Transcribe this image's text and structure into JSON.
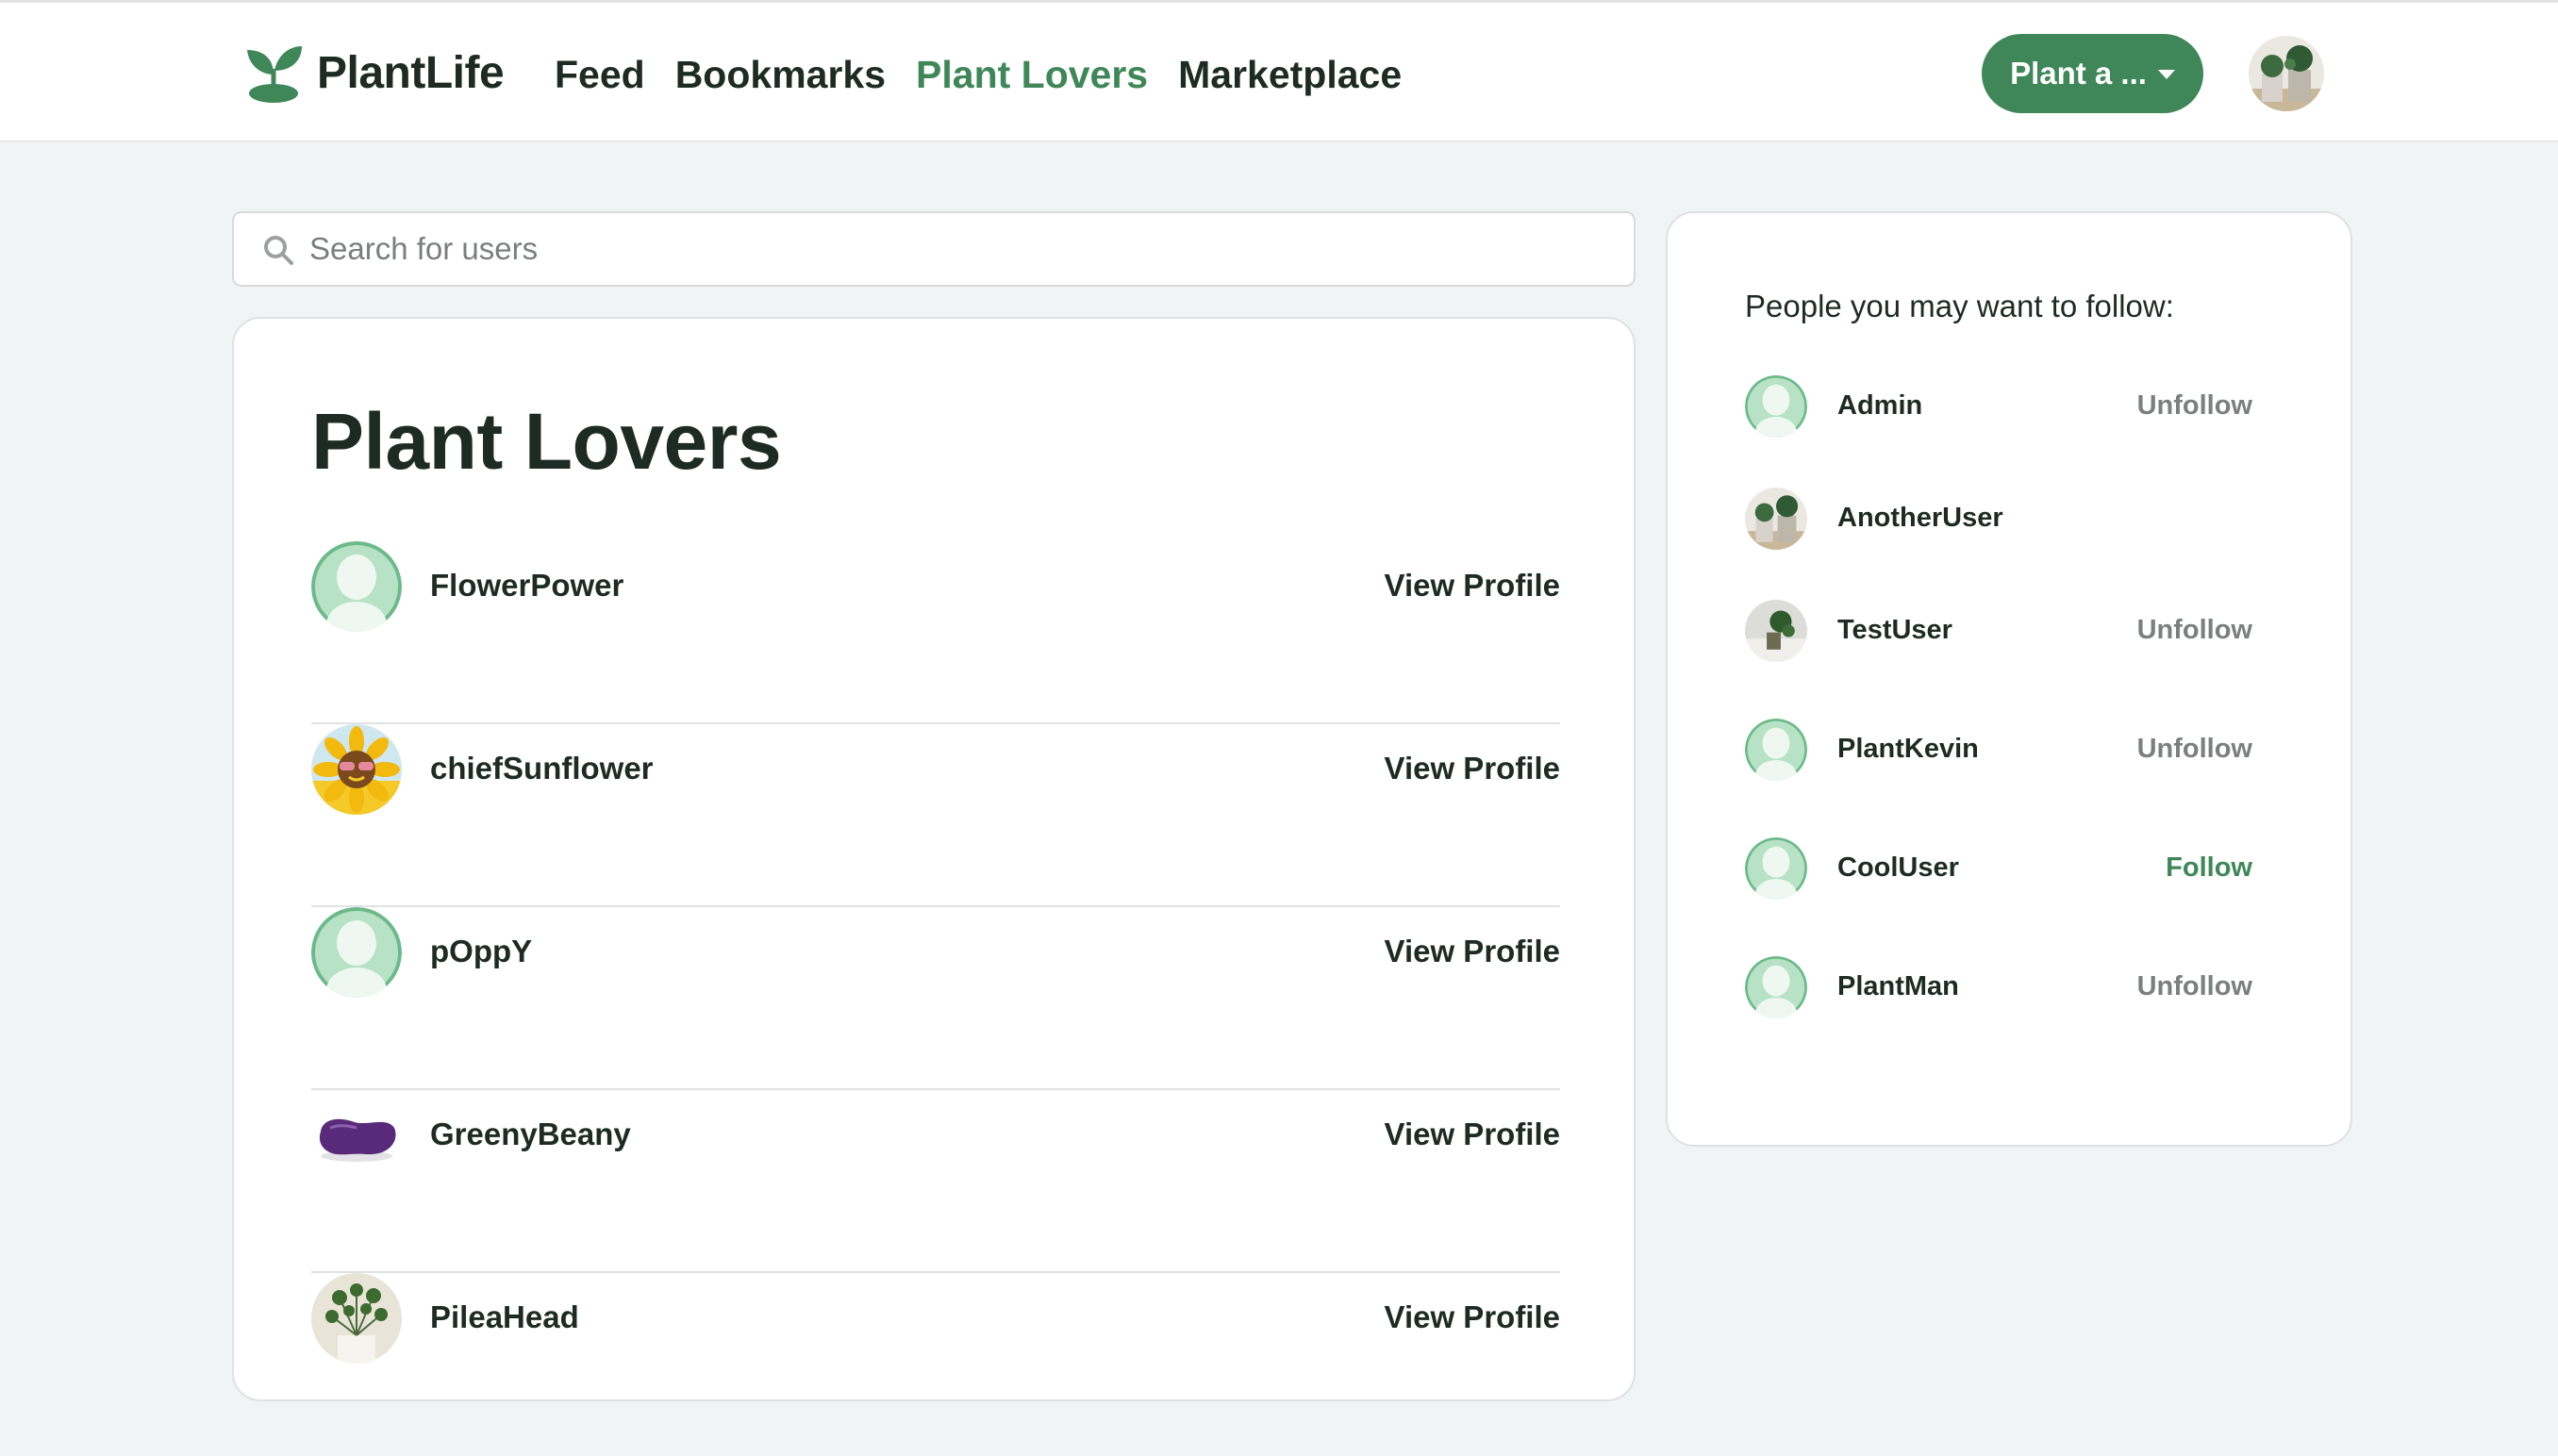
{
  "app": {
    "name": "PlantLife"
  },
  "nav": {
    "links": [
      {
        "label": "Feed",
        "active": false
      },
      {
        "label": "Bookmarks",
        "active": false
      },
      {
        "label": "Plant Lovers",
        "active": true
      },
      {
        "label": "Marketplace",
        "active": false
      }
    ],
    "action_button": "Plant a ..."
  },
  "search": {
    "placeholder": "Search for users",
    "value": ""
  },
  "main": {
    "title": "Plant Lovers",
    "users": [
      {
        "name": "FlowerPower",
        "avatar": "default-avatar-icon",
        "action": "View Profile"
      },
      {
        "name": "chiefSunflower",
        "avatar": "sunflower-avatar",
        "action": "View Profile"
      },
      {
        "name": "pOppY",
        "avatar": "default-avatar-icon",
        "action": "View Profile"
      },
      {
        "name": "GreenyBeany",
        "avatar": "purple-bean-avatar",
        "action": "View Profile"
      },
      {
        "name": "PileaHead",
        "avatar": "pilea-plant-avatar",
        "action": "View Profile"
      }
    ]
  },
  "sidebar": {
    "title": "People you may want to follow:",
    "users": [
      {
        "name": "Admin",
        "avatar": "default-avatar-icon",
        "action": "Unfollow"
      },
      {
        "name": "AnotherUser",
        "avatar": "potted-plants-avatar",
        "action": ""
      },
      {
        "name": "TestUser",
        "avatar": "plant-photo-avatar",
        "action": "Unfollow"
      },
      {
        "name": "PlantKevin",
        "avatar": "default-avatar-icon",
        "action": "Unfollow"
      },
      {
        "name": "CoolUser",
        "avatar": "default-avatar-icon",
        "action": "Follow"
      },
      {
        "name": "PlantMan",
        "avatar": "default-avatar-icon",
        "action": "Unfollow"
      }
    ]
  },
  "colors": {
    "brand_green": "#3f8758",
    "avatar_green": "#6cb98a",
    "text_dark": "#1e2b24",
    "muted": "#7b807e",
    "background": "#f1f4f4"
  }
}
